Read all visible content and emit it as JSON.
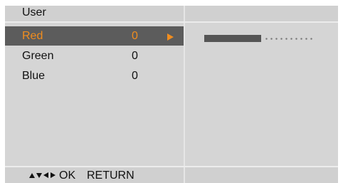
{
  "menu": {
    "title": "User",
    "items": [
      {
        "label": "Red",
        "value": "0",
        "selected": true
      },
      {
        "label": "Green",
        "value": "0",
        "selected": false
      },
      {
        "label": "Blue",
        "value": "0",
        "selected": false
      }
    ]
  },
  "adjust_bar": {
    "level_fraction": 0.52
  },
  "footer": {
    "nav_icons": [
      "up-arrow-icon",
      "down-arrow-icon",
      "left-arrow-icon",
      "right-arrow-icon"
    ],
    "ok_label": "OK",
    "return_label": "RETURN"
  },
  "colors": {
    "selected_text": "#f18d1e",
    "selected_bg": "#5c5c5c",
    "panel_bg": "#d5d5d5",
    "bar_fill": "#555555"
  }
}
